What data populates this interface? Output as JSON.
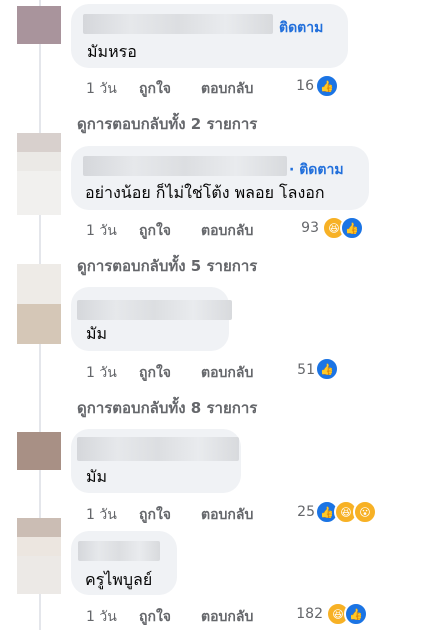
{
  "follow_label": "ติดตาม",
  "actions": {
    "time": "1 วัน",
    "like": "ถูกใจ",
    "reply": "ตอบกลับ"
  },
  "comments": [
    {
      "text": "มัมหรอ",
      "follow": "ติดตาม",
      "reaction_count": "16",
      "reactions": [
        "like"
      ]
    },
    {
      "text": "อย่างน้อย ก็ไม่ใช่โต้ง พลอย โลงอก",
      "follow": "· ติดตาม",
      "reaction_count": "93",
      "reactions": [
        "haha",
        "like"
      ]
    },
    {
      "text": "มัม",
      "reaction_count": "51",
      "reactions": [
        "like"
      ]
    },
    {
      "text": "มัม",
      "reaction_count": "25",
      "reactions": [
        "like",
        "haha",
        "wow"
      ]
    },
    {
      "text": "ครูไพบูลย์",
      "reaction_count": "182",
      "reactions": [
        "haha",
        "like"
      ]
    }
  ],
  "view_replies": [
    "ดูการตอบกลับทั้ง 2 รายการ",
    "ดูการตอบกลับทั้ง 5 รายการ",
    "ดูการตอบกลับทั้ง 8 รายการ"
  ]
}
